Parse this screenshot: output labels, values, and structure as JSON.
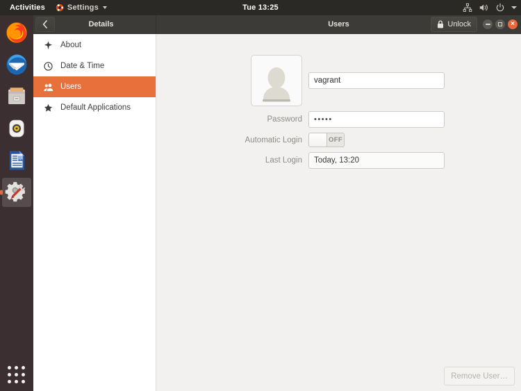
{
  "topbar": {
    "activities_label": "Activities",
    "app_menu_label": "Settings",
    "clock": "Tue 13:25",
    "tray_icons": [
      "network-icon",
      "volume-icon",
      "power-icon",
      "chevron-down-icon"
    ]
  },
  "dock": {
    "items": [
      {
        "name": "firefox",
        "label": "Firefox",
        "active": false
      },
      {
        "name": "thunderbird",
        "label": "Thunderbird",
        "active": false
      },
      {
        "name": "files",
        "label": "Files",
        "active": false
      },
      {
        "name": "rhythmbox",
        "label": "Rhythmbox",
        "active": false
      },
      {
        "name": "libreoffice-writer",
        "label": "LibreOffice Writer",
        "active": false
      },
      {
        "name": "settings",
        "label": "Settings",
        "active": true
      }
    ],
    "show_applications_label": "Show Applications"
  },
  "window": {
    "header": {
      "back_icon": "chevron-left-icon",
      "left_title": "Details",
      "right_title": "Users",
      "unlock_label": "Unlock",
      "unlock_icon": "padlock-icon",
      "minimize_label": "Minimize",
      "maximize_label": "Maximize",
      "close_label": "Close"
    },
    "sidebar": {
      "items": [
        {
          "label": "About",
          "icon": "sparkle-icon",
          "selected": false
        },
        {
          "label": "Date & Time",
          "icon": "clock-icon",
          "selected": false
        },
        {
          "label": "Users",
          "icon": "users-icon",
          "selected": true
        },
        {
          "label": "Default Applications",
          "icon": "star-icon",
          "selected": false
        }
      ]
    },
    "content": {
      "avatar_alt": "user-avatar-placeholder",
      "username": "vagrant",
      "fields": [
        {
          "label": "Password",
          "value": "•••••"
        },
        {
          "label": "Automatic Login",
          "value": "OFF"
        },
        {
          "label": "Last Login",
          "value": "Today, 13:20"
        }
      ],
      "remove_user_label": "Remove User…"
    }
  },
  "colors": {
    "accent_orange": "#e8703a",
    "topbar_bg": "#2b2925",
    "headerbar_bg": "#3c3b37",
    "dock_bg": "#3b2f31",
    "content_bg": "#f2f1f0",
    "sidebar_bg": "#ffffff"
  }
}
